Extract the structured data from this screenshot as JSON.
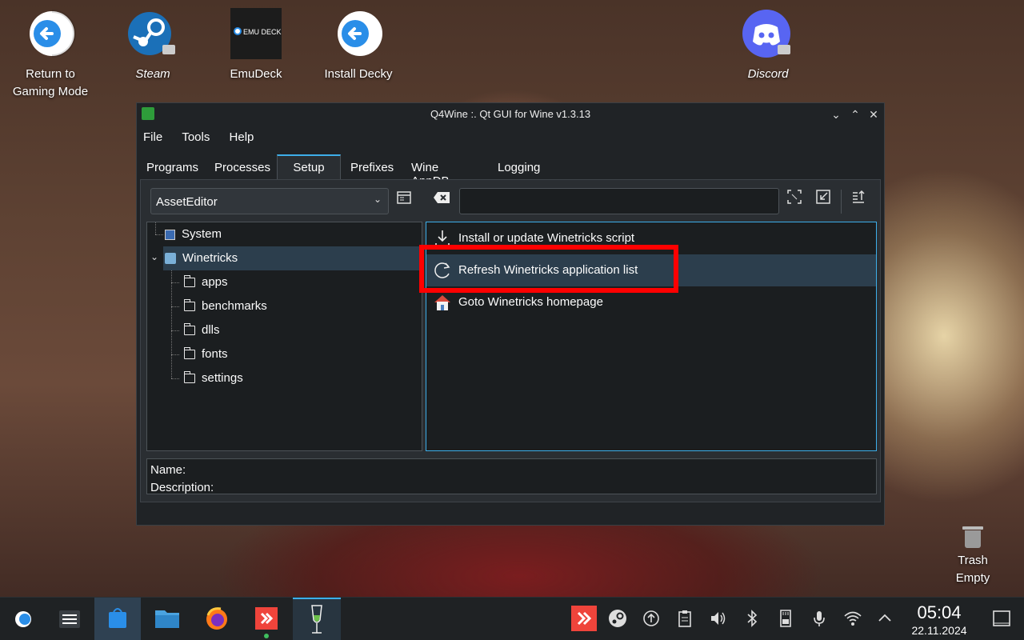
{
  "desktop": {
    "icons": [
      {
        "label": "Return to\nGaming Mode",
        "icon": "return-arrow-icon"
      },
      {
        "label": "Steam",
        "icon": "steam-icon"
      },
      {
        "label": "EmuDeck",
        "icon": "emudeck-icon",
        "logo_text": "EMU DECK"
      },
      {
        "label": "Install Decky",
        "icon": "return-arrow-icon"
      },
      {
        "label": "Discord",
        "icon": "discord-icon"
      }
    ],
    "trash": {
      "line1": "Trash",
      "line2": "Empty"
    }
  },
  "window": {
    "title": "Q4Wine :. Qt GUI for Wine v1.3.13",
    "menu": [
      "File",
      "Tools",
      "Help"
    ],
    "tabs": [
      "Programs",
      "Processes",
      "Setup",
      "Prefixes",
      "Wine AppDB",
      "Logging"
    ],
    "active_tab": "Setup",
    "prefix_combo": "AssetEditor",
    "search_value": "",
    "tree": {
      "items": [
        {
          "label": "System"
        },
        {
          "label": "Winetricks",
          "expanded": true,
          "selected": true,
          "children": [
            "apps",
            "benchmarks",
            "dlls",
            "fonts",
            "settings"
          ]
        }
      ]
    },
    "actions": [
      {
        "label": "Install or update Winetricks script",
        "icon": "download-icon"
      },
      {
        "label": "Refresh Winetricks application list",
        "icon": "refresh-icon",
        "selected": true
      },
      {
        "label": "Goto Winetricks homepage",
        "icon": "home-icon"
      }
    ],
    "info": {
      "name_label": "Name:",
      "description_label": "Description:"
    }
  },
  "taskbar": {
    "time": "05:04",
    "date": "22.11.2024"
  },
  "colors": {
    "accent": "#3daee9",
    "highlight_box": "#ff0000",
    "window_bg": "#202326"
  }
}
